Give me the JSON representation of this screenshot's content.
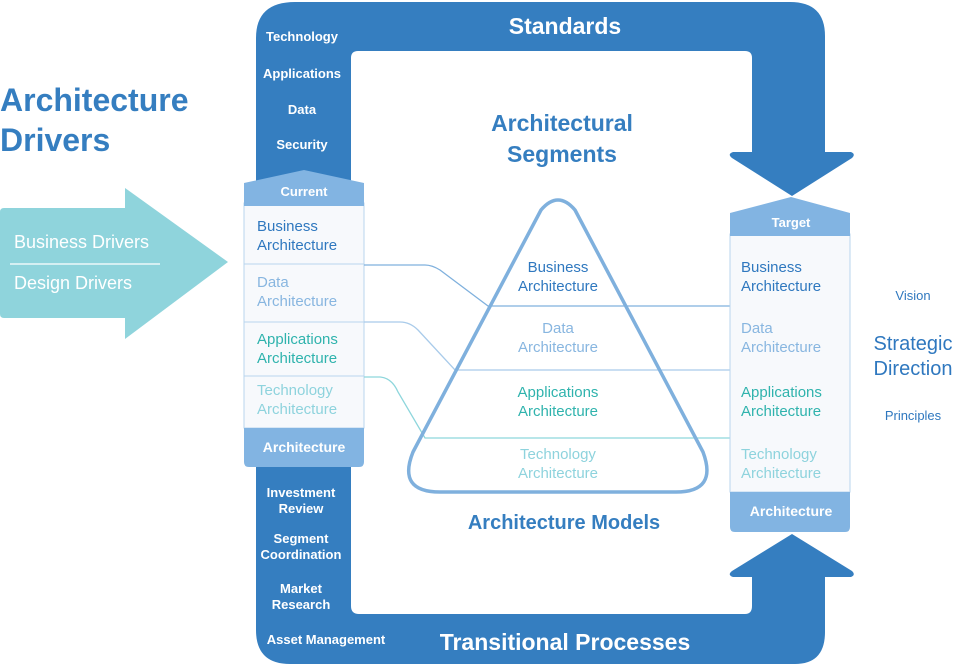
{
  "colors": {
    "dark_blue": "#357ec0",
    "mid_blue": "#82b4e2",
    "light_blue_text": "#8fbde6",
    "business_text": "#2f78bf",
    "data_text": "#88b6e0",
    "applications_text": "#2fb3ad",
    "technology_text": "#8ed3dd",
    "teal_arrow": "#8fd4dc",
    "panel_bg": "#f7f9fc",
    "panel_border": "#b9d5ee",
    "white": "#ffffff"
  },
  "left": {
    "title_line1": "Architecture",
    "title_line2": "Drivers",
    "arrow_item1": "Business Drivers",
    "arrow_item2": "Design Drivers"
  },
  "frame": {
    "top_label": "Standards",
    "bottom_label": "Transitional Processes",
    "top_side_items": [
      "Technology",
      "Applications",
      "Data",
      "Security"
    ],
    "bottom_side_items": [
      {
        "line1": "Investment",
        "line2": "Review"
      },
      {
        "line1": "Segment",
        "line2": "Coordination"
      },
      {
        "line1": "Market",
        "line2": "Research"
      },
      {
        "line1": "Asset Management",
        "line2": ""
      }
    ]
  },
  "current": {
    "header": "Current",
    "footer": "Architecture",
    "rows": [
      {
        "line1": "Business",
        "line2": "Architecture"
      },
      {
        "line1": "Data",
        "line2": "Architecture"
      },
      {
        "line1": "Applications",
        "line2": "Architecture"
      },
      {
        "line1": "Technology",
        "line2": "Architecture"
      }
    ]
  },
  "center": {
    "title_line1": "Architectural",
    "title_line2": "Segments",
    "pyramid_rows": [
      {
        "line1": "Business",
        "line2": "Architecture"
      },
      {
        "line1": "Data",
        "line2": "Architecture"
      },
      {
        "line1": "Applications",
        "line2": "Architecture"
      },
      {
        "line1": "Technology",
        "line2": "Architecture"
      }
    ],
    "caption": "Architecture Models"
  },
  "target": {
    "header": "Target",
    "footer": "Architecture",
    "rows": [
      {
        "line1": "Business",
        "line2": "Architecture"
      },
      {
        "line1": "Data",
        "line2": "Architecture"
      },
      {
        "line1": "Applications",
        "line2": "Architecture"
      },
      {
        "line1": "Technology",
        "line2": "Architecture"
      }
    ]
  },
  "right": {
    "vision": "Vision",
    "title_line1": "Strategic",
    "title_line2": "Direction",
    "principles": "Principles"
  }
}
